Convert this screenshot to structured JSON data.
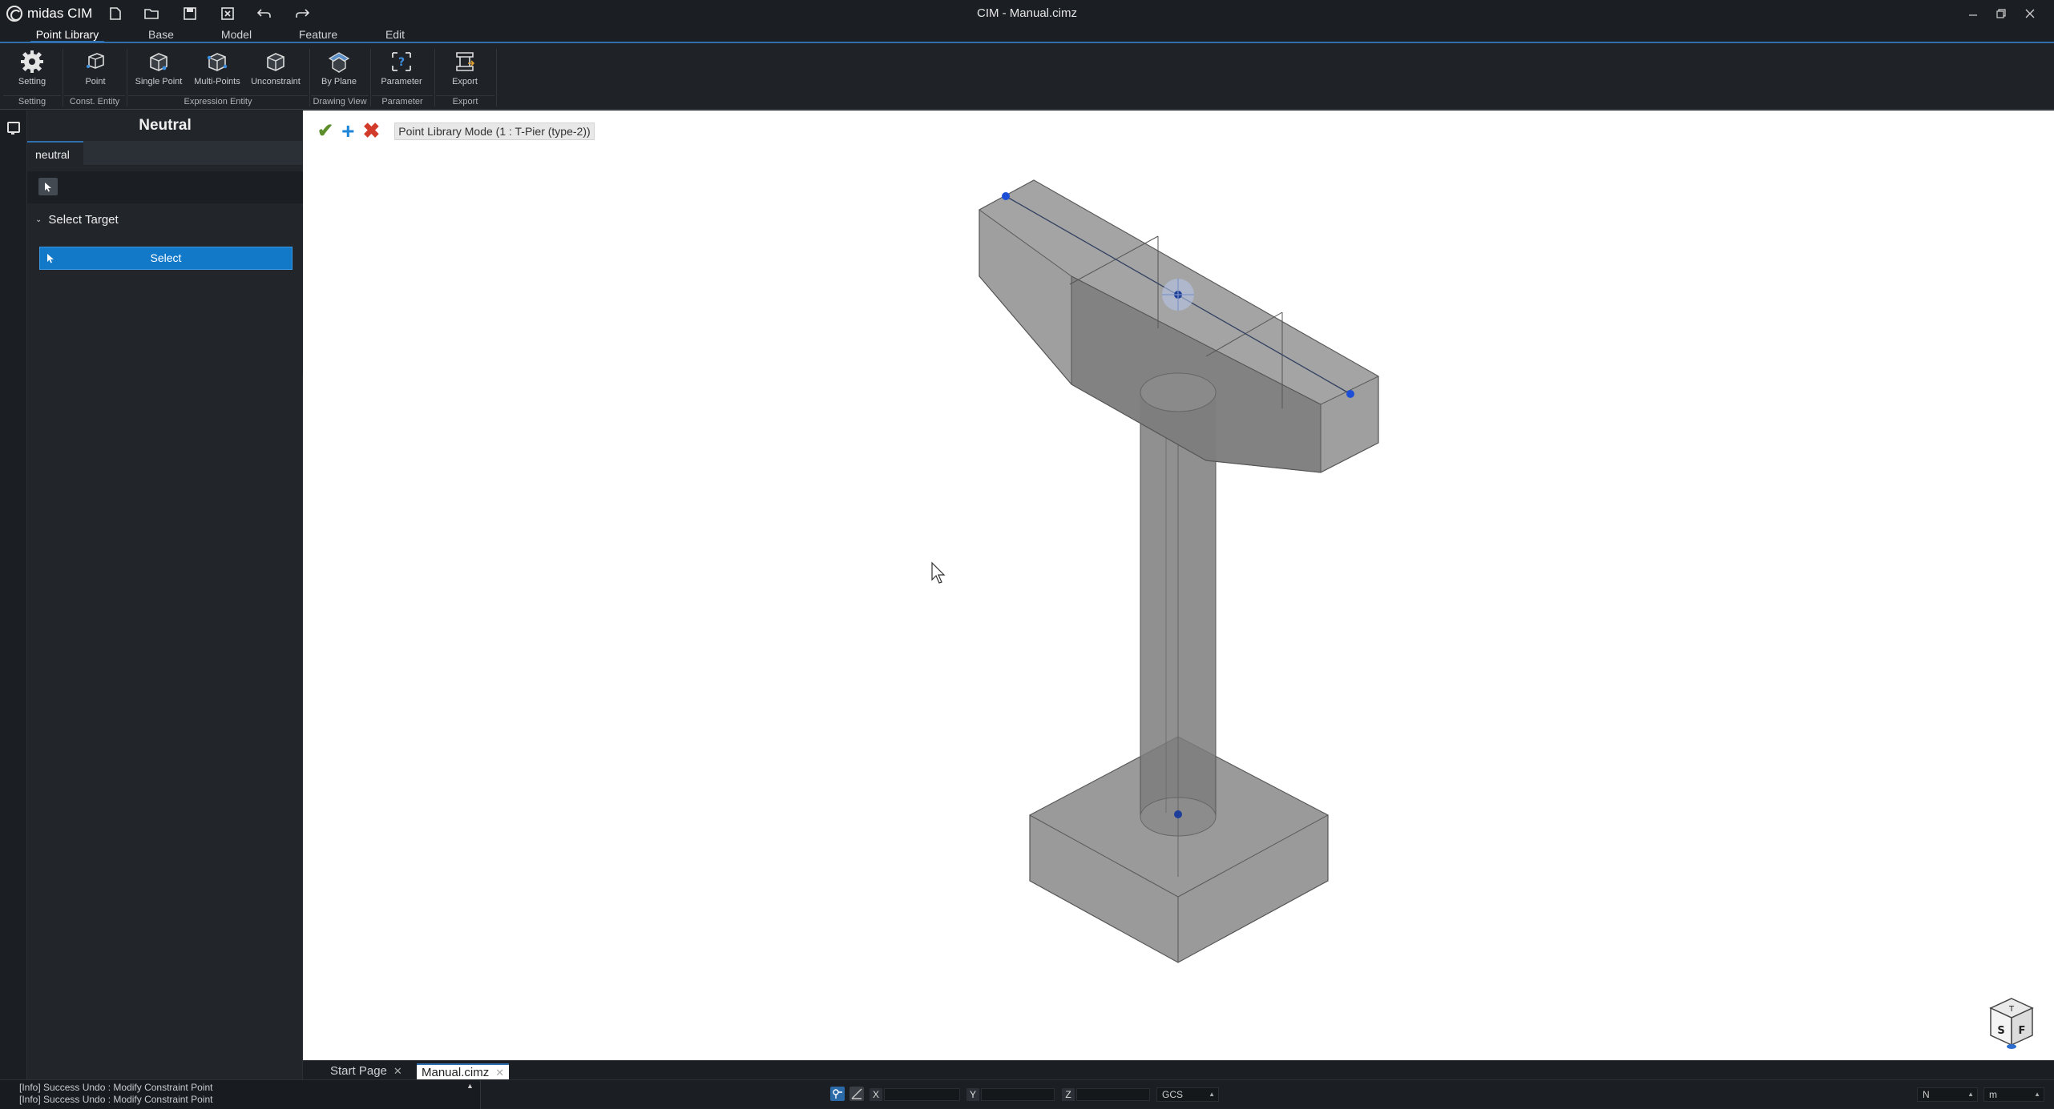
{
  "app": {
    "brand": "midas CIM",
    "title": "CIM - Manual.cimz"
  },
  "ribbon_tabs": [
    {
      "label": "Point Library"
    },
    {
      "label": "Base"
    },
    {
      "label": "Model"
    },
    {
      "label": "Feature"
    },
    {
      "label": "Edit"
    }
  ],
  "ribbon": {
    "buttons": [
      {
        "label": "Setting",
        "icon": "gear-icon"
      },
      {
        "label": "Point",
        "icon": "point-box-icon"
      },
      {
        "label": "Single Point",
        "icon": "single-point-box-icon"
      },
      {
        "label": "Multi-Points",
        "icon": "multi-points-box-icon"
      },
      {
        "label": "Unconstraint",
        "icon": "unconstraint-box-icon"
      },
      {
        "label": "By Plane",
        "icon": "by-plane-icon"
      },
      {
        "label": "Parameter",
        "icon": "parameter-icon"
      },
      {
        "label": "Export",
        "icon": "export-icon"
      }
    ],
    "groups": [
      {
        "label": "Setting"
      },
      {
        "label": "Const. Entity"
      },
      {
        "label": "Expression Entity"
      },
      {
        "label": "Drawing View"
      },
      {
        "label": "Parameter"
      },
      {
        "label": "Export"
      }
    ]
  },
  "panel": {
    "title": "Neutral",
    "tab": "neutral",
    "section_title": "Select Target",
    "select_button": "Select"
  },
  "viewport": {
    "mode_label": "Point Library Mode (1 : T-Pier (type-2))"
  },
  "doc_tabs": [
    {
      "label": "Start Page",
      "active": false
    },
    {
      "label": "Manual.cimz",
      "active": true
    }
  ],
  "statusbar": {
    "log": [
      "[Info] Success Undo : Modify Constraint Point",
      "[Info] Success Undo : Modify Constraint Point"
    ],
    "coord_labels": [
      "X",
      "Y",
      "Z"
    ],
    "coord_system": "GCS",
    "force_unit": "N",
    "length_unit": "m"
  },
  "colors": {
    "accent": "#2f6fae",
    "select_button": "#1279c9",
    "confirm": "#5c8f2c",
    "add": "#1f86d8",
    "cancel": "#d23a2a"
  }
}
